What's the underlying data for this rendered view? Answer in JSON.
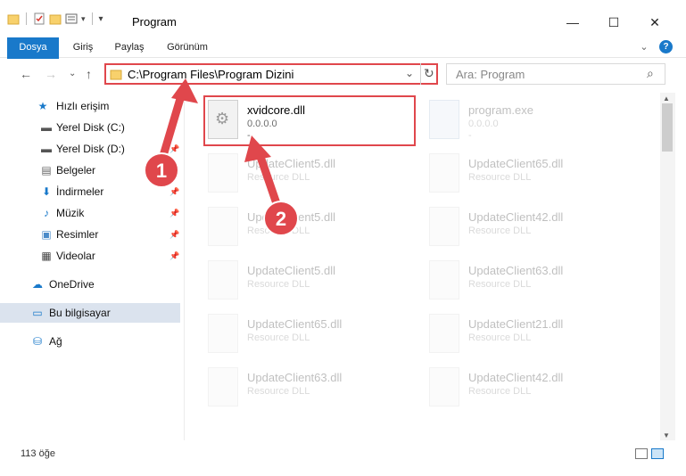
{
  "window": {
    "title": "Program",
    "minimize_icon": "—",
    "maximize_icon": "☐",
    "close_icon": "✕"
  },
  "ribbon": {
    "tabs": [
      "Dosya",
      "Giriş",
      "Paylaş",
      "Görünüm"
    ],
    "expand_icon": "⌄",
    "help_icon": "?"
  },
  "nav": {
    "back_icon": "←",
    "forward_icon": "→",
    "dropdown_icon": "⌄",
    "up_icon": "↑",
    "address": "C:\\Program Files\\Program Dizini",
    "address_dropdown": "⌄",
    "refresh_icon": "↻",
    "search_placeholder": "Ara: Program",
    "search_icon": "⌕"
  },
  "sidebar": {
    "items": [
      {
        "label": "Hızlı erişim",
        "icon": "★"
      },
      {
        "label": "Yerel Disk (C:)",
        "icon": "▬"
      },
      {
        "label": "Yerel Disk (D:)",
        "icon": "▬"
      },
      {
        "label": "Belgeler",
        "icon": "▤"
      },
      {
        "label": "İndirmeler",
        "icon": "⬇"
      },
      {
        "label": "Müzik",
        "icon": "♪"
      },
      {
        "label": "Resimler",
        "icon": "▣"
      },
      {
        "label": "Videolar",
        "icon": "▦"
      },
      {
        "label": "OneDrive",
        "icon": "☁"
      },
      {
        "label": "Bu bilgisayar",
        "icon": "▭"
      },
      {
        "label": "Ağ",
        "icon": "⛁"
      }
    ],
    "pin_icon": "📌"
  },
  "files": [
    {
      "name": "xvidcore.dll",
      "sub": "0.0.0.0",
      "sub2": "-"
    },
    {
      "name": "program.exe",
      "sub": "0.0.0.0",
      "sub2": "-"
    },
    {
      "name": "UpdateClient5.dll",
      "sub": "Resource DLL"
    },
    {
      "name": "UpdateClient65.dll",
      "sub": "Resource DLL"
    },
    {
      "name": "UpdateClient5.dll",
      "sub": "Resource DLL"
    },
    {
      "name": "UpdateClient42.dll",
      "sub": "Resource DLL"
    },
    {
      "name": "UpdateClient5.dll",
      "sub": "Resource DLL"
    },
    {
      "name": "UpdateClient63.dll",
      "sub": "Resource DLL"
    },
    {
      "name": "UpdateClient65.dll",
      "sub": "Resource DLL"
    },
    {
      "name": "UpdateClient21.dll",
      "sub": "Resource DLL"
    },
    {
      "name": "UpdateClient63.dll",
      "sub": "Resource DLL"
    },
    {
      "name": "UpdateClient42.dll",
      "sub": "Resource DLL"
    }
  ],
  "annotations": {
    "step1": "1",
    "step2": "2",
    "accent": "#e0474c"
  },
  "status": {
    "count": "113 öğe"
  }
}
